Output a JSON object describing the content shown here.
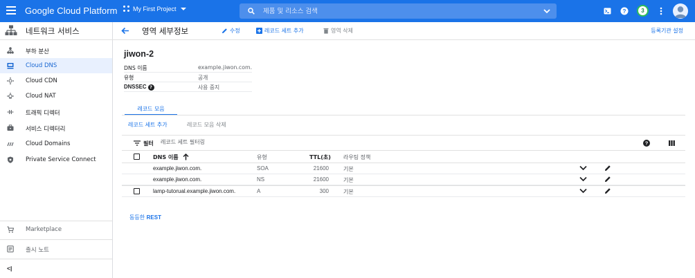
{
  "app": {
    "brand": "Google Cloud Platform",
    "project": "My First Project",
    "search_placeholder": "제품 및 리소스 검색",
    "notification_count": "3",
    "colors": {
      "topbar": "#1a73e8",
      "accent": "#1a73e8",
      "active_bg": "#e8f0fe"
    }
  },
  "sidebar": {
    "title": "네트워크 서비스",
    "items": [
      {
        "label": "부하 분산",
        "icon": "load-balancer-icon"
      },
      {
        "label": "Cloud DNS",
        "icon": "dns-icon",
        "active": true
      },
      {
        "label": "Cloud CDN",
        "icon": "cdn-icon"
      },
      {
        "label": "Cloud NAT",
        "icon": "nat-icon"
      },
      {
        "label": "트래픽 디렉터",
        "icon": "traffic-director-icon"
      },
      {
        "label": "서비스 디렉터리",
        "icon": "service-directory-icon"
      },
      {
        "label": "Cloud Domains",
        "icon": "domains-icon"
      },
      {
        "label": "Private Service Connect",
        "icon": "shield-icon"
      }
    ],
    "marketplace": "Marketplace",
    "release_notes": "출시 노트",
    "collapse_label": "<|"
  },
  "header": {
    "title": "영역 세부정보",
    "edit": "수정",
    "add_record_set": "레코드 세트 추가",
    "delete_zone": "영역 삭제",
    "registrar_setup": "등록기관 설정"
  },
  "zone": {
    "name": "jiwon-2",
    "details": [
      {
        "key": "DNS 이름",
        "value": "example.jiwon.com."
      },
      {
        "key": "유형",
        "value": "공개"
      },
      {
        "key": "DNSSEC",
        "value": "사용 중지"
      }
    ]
  },
  "tabs": {
    "record_sets": "레코드 모음"
  },
  "actions": {
    "add_record_set": "레코드 세트 추가",
    "delete_record_sets": "레코드 모음 삭제"
  },
  "filter": {
    "label": "필터",
    "placeholder": "레코드 세트 필터링"
  },
  "table": {
    "headers": {
      "dns_name": "DNS 이름",
      "type": "유형",
      "ttl": "TTL(초)",
      "routing": "라우팅 정책"
    },
    "rows": [
      {
        "dns_name": "example.jiwon.com.",
        "type": "SOA",
        "ttl": "21600",
        "routing": "기본",
        "checkbox": false
      },
      {
        "dns_name": "example.jiwon.com.",
        "type": "NS",
        "ttl": "21600",
        "routing": "기본",
        "checkbox": false
      },
      {
        "dns_name": "lamp-tutorual.example.jiwon.com.",
        "type": "A",
        "ttl": "300",
        "routing": "기본",
        "checkbox": true
      }
    ]
  },
  "footer": {
    "equivalent_rest": "동등한",
    "rest": "REST"
  }
}
